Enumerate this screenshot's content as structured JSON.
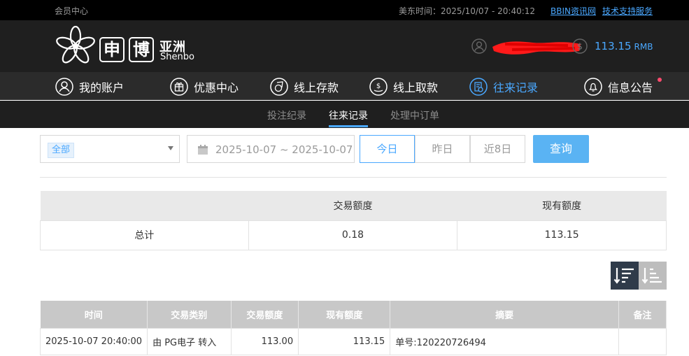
{
  "topbar": {
    "member_center": "会员中心",
    "time_label": "美东时间：",
    "time_value": "2025/10/07 - 20:40:12",
    "link_bbin": "BBIN资讯网",
    "link_support": "技术支持服务"
  },
  "brand": {
    "box1": "申",
    "box2": "博",
    "cn_name": "亚洲",
    "en_name": "Shenbo"
  },
  "account": {
    "balance": "113.15",
    "currency": "RMB"
  },
  "nav": {
    "items": [
      {
        "label": "我的账户",
        "icon": "user-icon"
      },
      {
        "label": "优惠中心",
        "icon": "gift-icon"
      },
      {
        "label": "线上存款",
        "icon": "deposit-icon"
      },
      {
        "label": "线上取款",
        "icon": "withdraw-icon"
      },
      {
        "label": "往来记录",
        "icon": "records-icon"
      },
      {
        "label": "信息公告",
        "icon": "bell-icon"
      }
    ],
    "active": "往来记录"
  },
  "subnav": {
    "tabs": [
      {
        "label": "投注纪录"
      },
      {
        "label": "往来记录"
      },
      {
        "label": "处理中订单"
      }
    ],
    "active": "往来记录"
  },
  "filters": {
    "type_selected": "全部",
    "date_range": "2025-10-07 ~ 2025-10-07",
    "quick_today": "今日",
    "quick_yesterday": "昨日",
    "quick_8days": "近8日",
    "query_label": "查询"
  },
  "summary": {
    "headers": [
      "",
      "交易额度",
      "现有额度"
    ],
    "row": [
      "总计",
      "0.18",
      "113.15"
    ]
  },
  "records": {
    "headers": [
      "时间",
      "交易类别",
      "交易额度",
      "现有额度",
      "摘要",
      "备注"
    ],
    "rows": [
      [
        "2025-10-07 20:40:00",
        "由 PG电子 转入",
        "113.00",
        "113.15",
        "单号:120220726494",
        ""
      ]
    ]
  },
  "colors": {
    "accent": "#4aa8ff",
    "query_button": "#5ab3f3",
    "header_bg": "#1f1f1f",
    "redaction": "#ff1a1a",
    "notice_dot": "#ff4b6e"
  }
}
